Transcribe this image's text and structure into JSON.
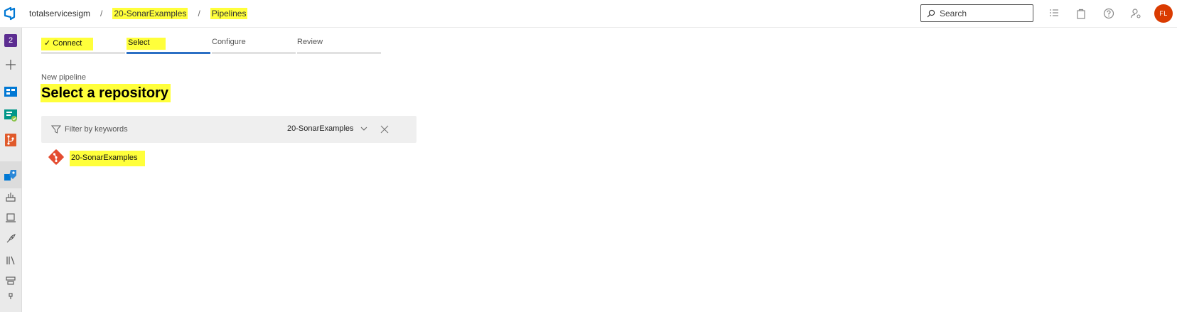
{
  "header": {
    "breadcrumbs": [
      {
        "label": "totalservicesigm"
      },
      {
        "label": "20-SonarExamples"
      },
      {
        "label": "Pipelines"
      }
    ],
    "search": {
      "placeholder": "Search"
    },
    "avatar_initials": "FL",
    "icons": [
      "list-icon",
      "shopping-bag-icon",
      "help-icon",
      "user-settings-icon"
    ]
  },
  "sidebar": {
    "project_badge": "2",
    "items": [
      "add-icon",
      "boards-icon",
      "test-plans-icon",
      "repos-icon",
      "pipelines-icon",
      "builds-icon",
      "environments-icon",
      "releases-icon",
      "library-icon",
      "task-groups-icon",
      "deployment-groups-icon"
    ]
  },
  "wizard": {
    "steps": [
      {
        "label": "Connect",
        "state": "done",
        "checkmark": "✓"
      },
      {
        "label": "Select",
        "state": "active"
      },
      {
        "label": "Configure",
        "state": "pending"
      },
      {
        "label": "Review",
        "state": "pending"
      }
    ]
  },
  "page": {
    "subtitle": "New pipeline",
    "title": "Select a repository"
  },
  "filter": {
    "placeholder": "Filter by keywords",
    "selected_repo": "20-SonarExamples"
  },
  "repositories": [
    {
      "name": "20-SonarExamples"
    }
  ],
  "colors": {
    "accent": "#2b6fc4",
    "highlight": "#ffff3b",
    "avatar": "#da3b01",
    "git": "#e44c30",
    "project_badge": "#5c2d91"
  }
}
